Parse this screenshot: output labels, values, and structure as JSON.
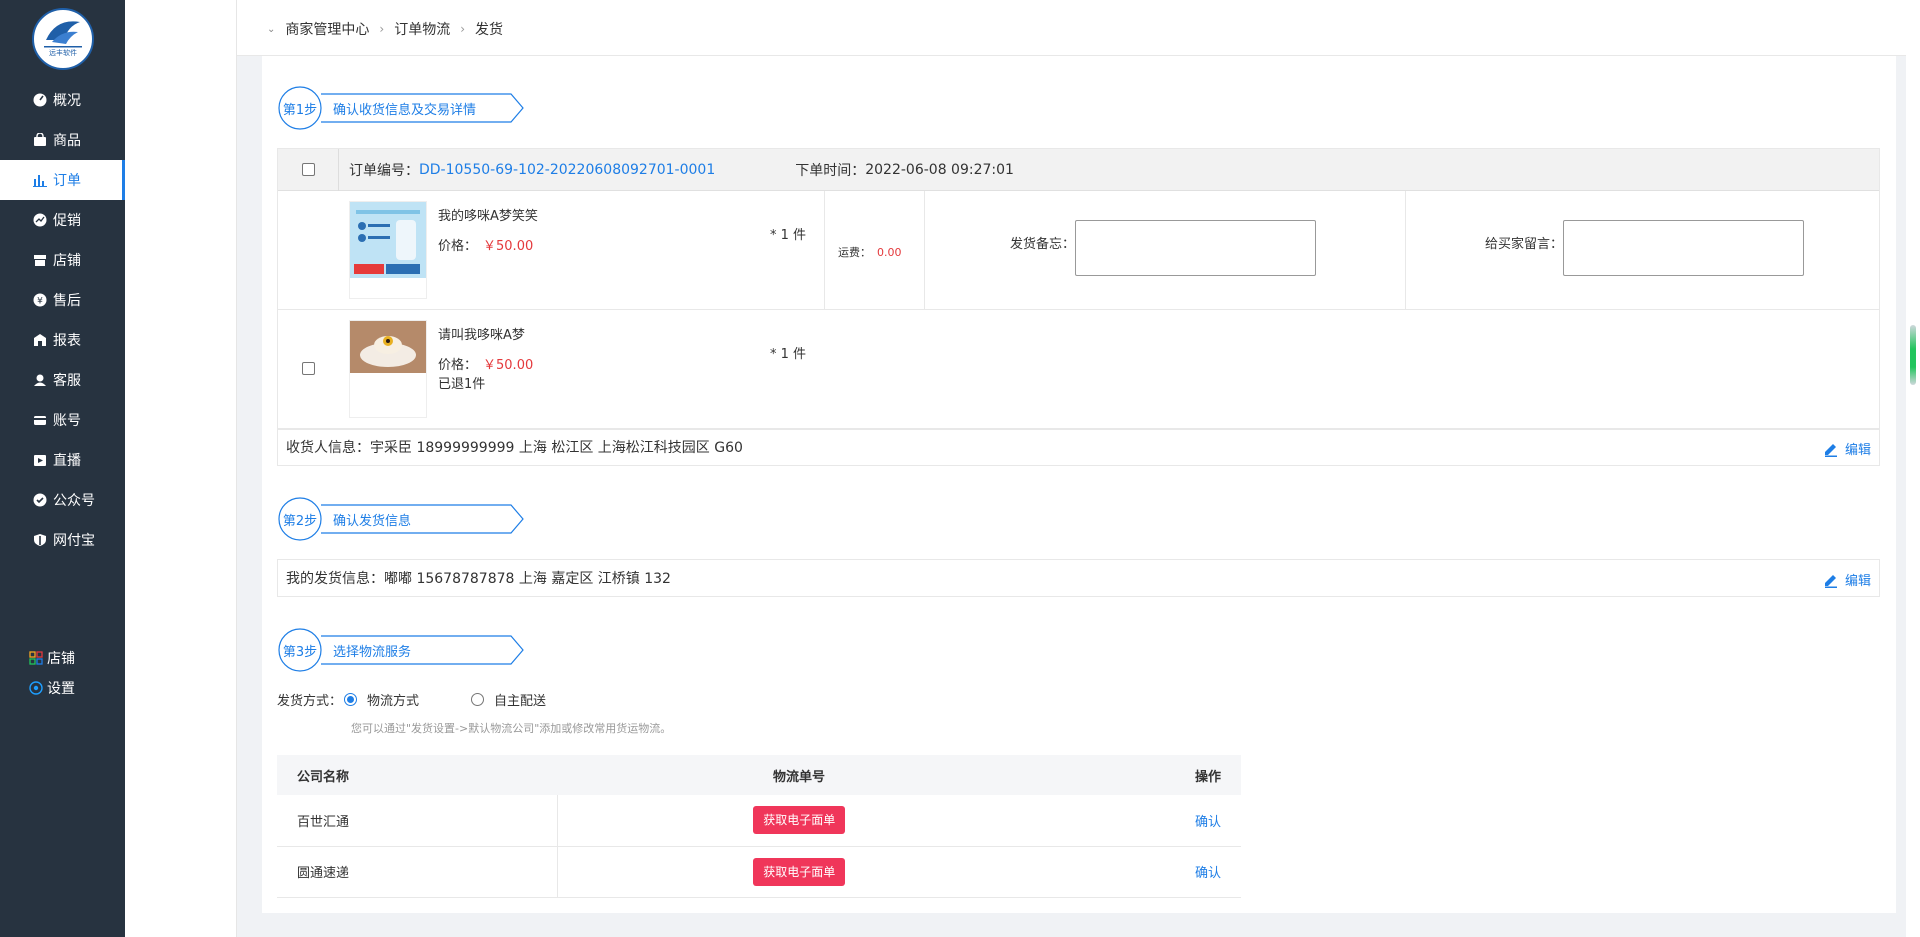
{
  "sidebar": {
    "logo_text": "远丰软件",
    "items": [
      {
        "label": "概况",
        "icon": "dashboard-icon",
        "active": false
      },
      {
        "label": "商品",
        "icon": "bag-icon",
        "active": false
      },
      {
        "label": "订单",
        "icon": "bar-chart-icon",
        "active": true
      },
      {
        "label": "促销",
        "icon": "promo-icon",
        "active": false
      },
      {
        "label": "店铺",
        "icon": "store-icon",
        "active": false
      },
      {
        "label": "售后",
        "icon": "after-sale-icon",
        "active": false
      },
      {
        "label": "报表",
        "icon": "report-icon",
        "active": false
      },
      {
        "label": "客服",
        "icon": "customer-service-icon",
        "active": false
      },
      {
        "label": "账号",
        "icon": "card-icon",
        "active": false
      },
      {
        "label": "直播",
        "icon": "live-icon",
        "active": false
      },
      {
        "label": "公众号",
        "icon": "shield-check-icon",
        "active": false
      },
      {
        "label": "网付宝",
        "icon": "shield-icon",
        "active": false
      }
    ],
    "bottom": [
      {
        "label": "店铺",
        "icon": "grid-icon"
      },
      {
        "label": "设置",
        "icon": "settings-icon"
      }
    ]
  },
  "breadcrumb": [
    "商家管理中心",
    "订单物流",
    "发货"
  ],
  "steps": [
    {
      "num": "第1步",
      "title": "确认收货信息及交易详情"
    },
    {
      "num": "第2步",
      "title": "确认发货信息"
    },
    {
      "num": "第3步",
      "title": "选择物流服务"
    }
  ],
  "order": {
    "no_label": "订单编号：",
    "no": "DD-10550-69-102-20220608092701-0001",
    "time_label": "下单时间：",
    "time": "2022-06-08 09:27:01",
    "items": [
      {
        "name": "我的哆咪A梦笑笑",
        "price_label": "价格：",
        "price": "￥50.00",
        "qty": "* 1 件",
        "refund": ""
      },
      {
        "name": "请叫我哆咪A梦",
        "price_label": "价格：",
        "price": "￥50.00",
        "qty": "* 1 件",
        "refund": "已退1件"
      }
    ],
    "shipping_label": "运费：",
    "shipping": "0.00",
    "ship_note_label": "发货备忘：",
    "buyer_msg_label": "给买家留言：",
    "receiver_label": "收货人信息：",
    "receiver": "宇采臣 18999999999  上海 松江区 上海松江科技园区 G60",
    "edit_label": "编辑"
  },
  "sender": {
    "label": "我的发货信息：",
    "value": "嘟嘟 15678787878 上海 嘉定区 江桥镇 132",
    "edit_label": "编辑"
  },
  "delivery": {
    "label": "发货方式：",
    "options": [
      {
        "label": "物流方式",
        "checked": true
      },
      {
        "label": "自主配送",
        "checked": false
      }
    ],
    "tip": "您可以通过\"发货设置->默认物流公司\"添加或修改常用货运物流。"
  },
  "logistics": {
    "headers": [
      "公司名称",
      "物流单号",
      "操作"
    ],
    "rows": [
      {
        "company": "百世汇通",
        "btn": "获取电子面单",
        "action": "确认"
      },
      {
        "company": "圆通速递",
        "btn": "获取电子面单",
        "action": "确认"
      }
    ]
  },
  "colors": {
    "primary": "#1e7ee6",
    "sidebar": "#273340",
    "price": "#e4393c",
    "button": "#f0365a"
  }
}
